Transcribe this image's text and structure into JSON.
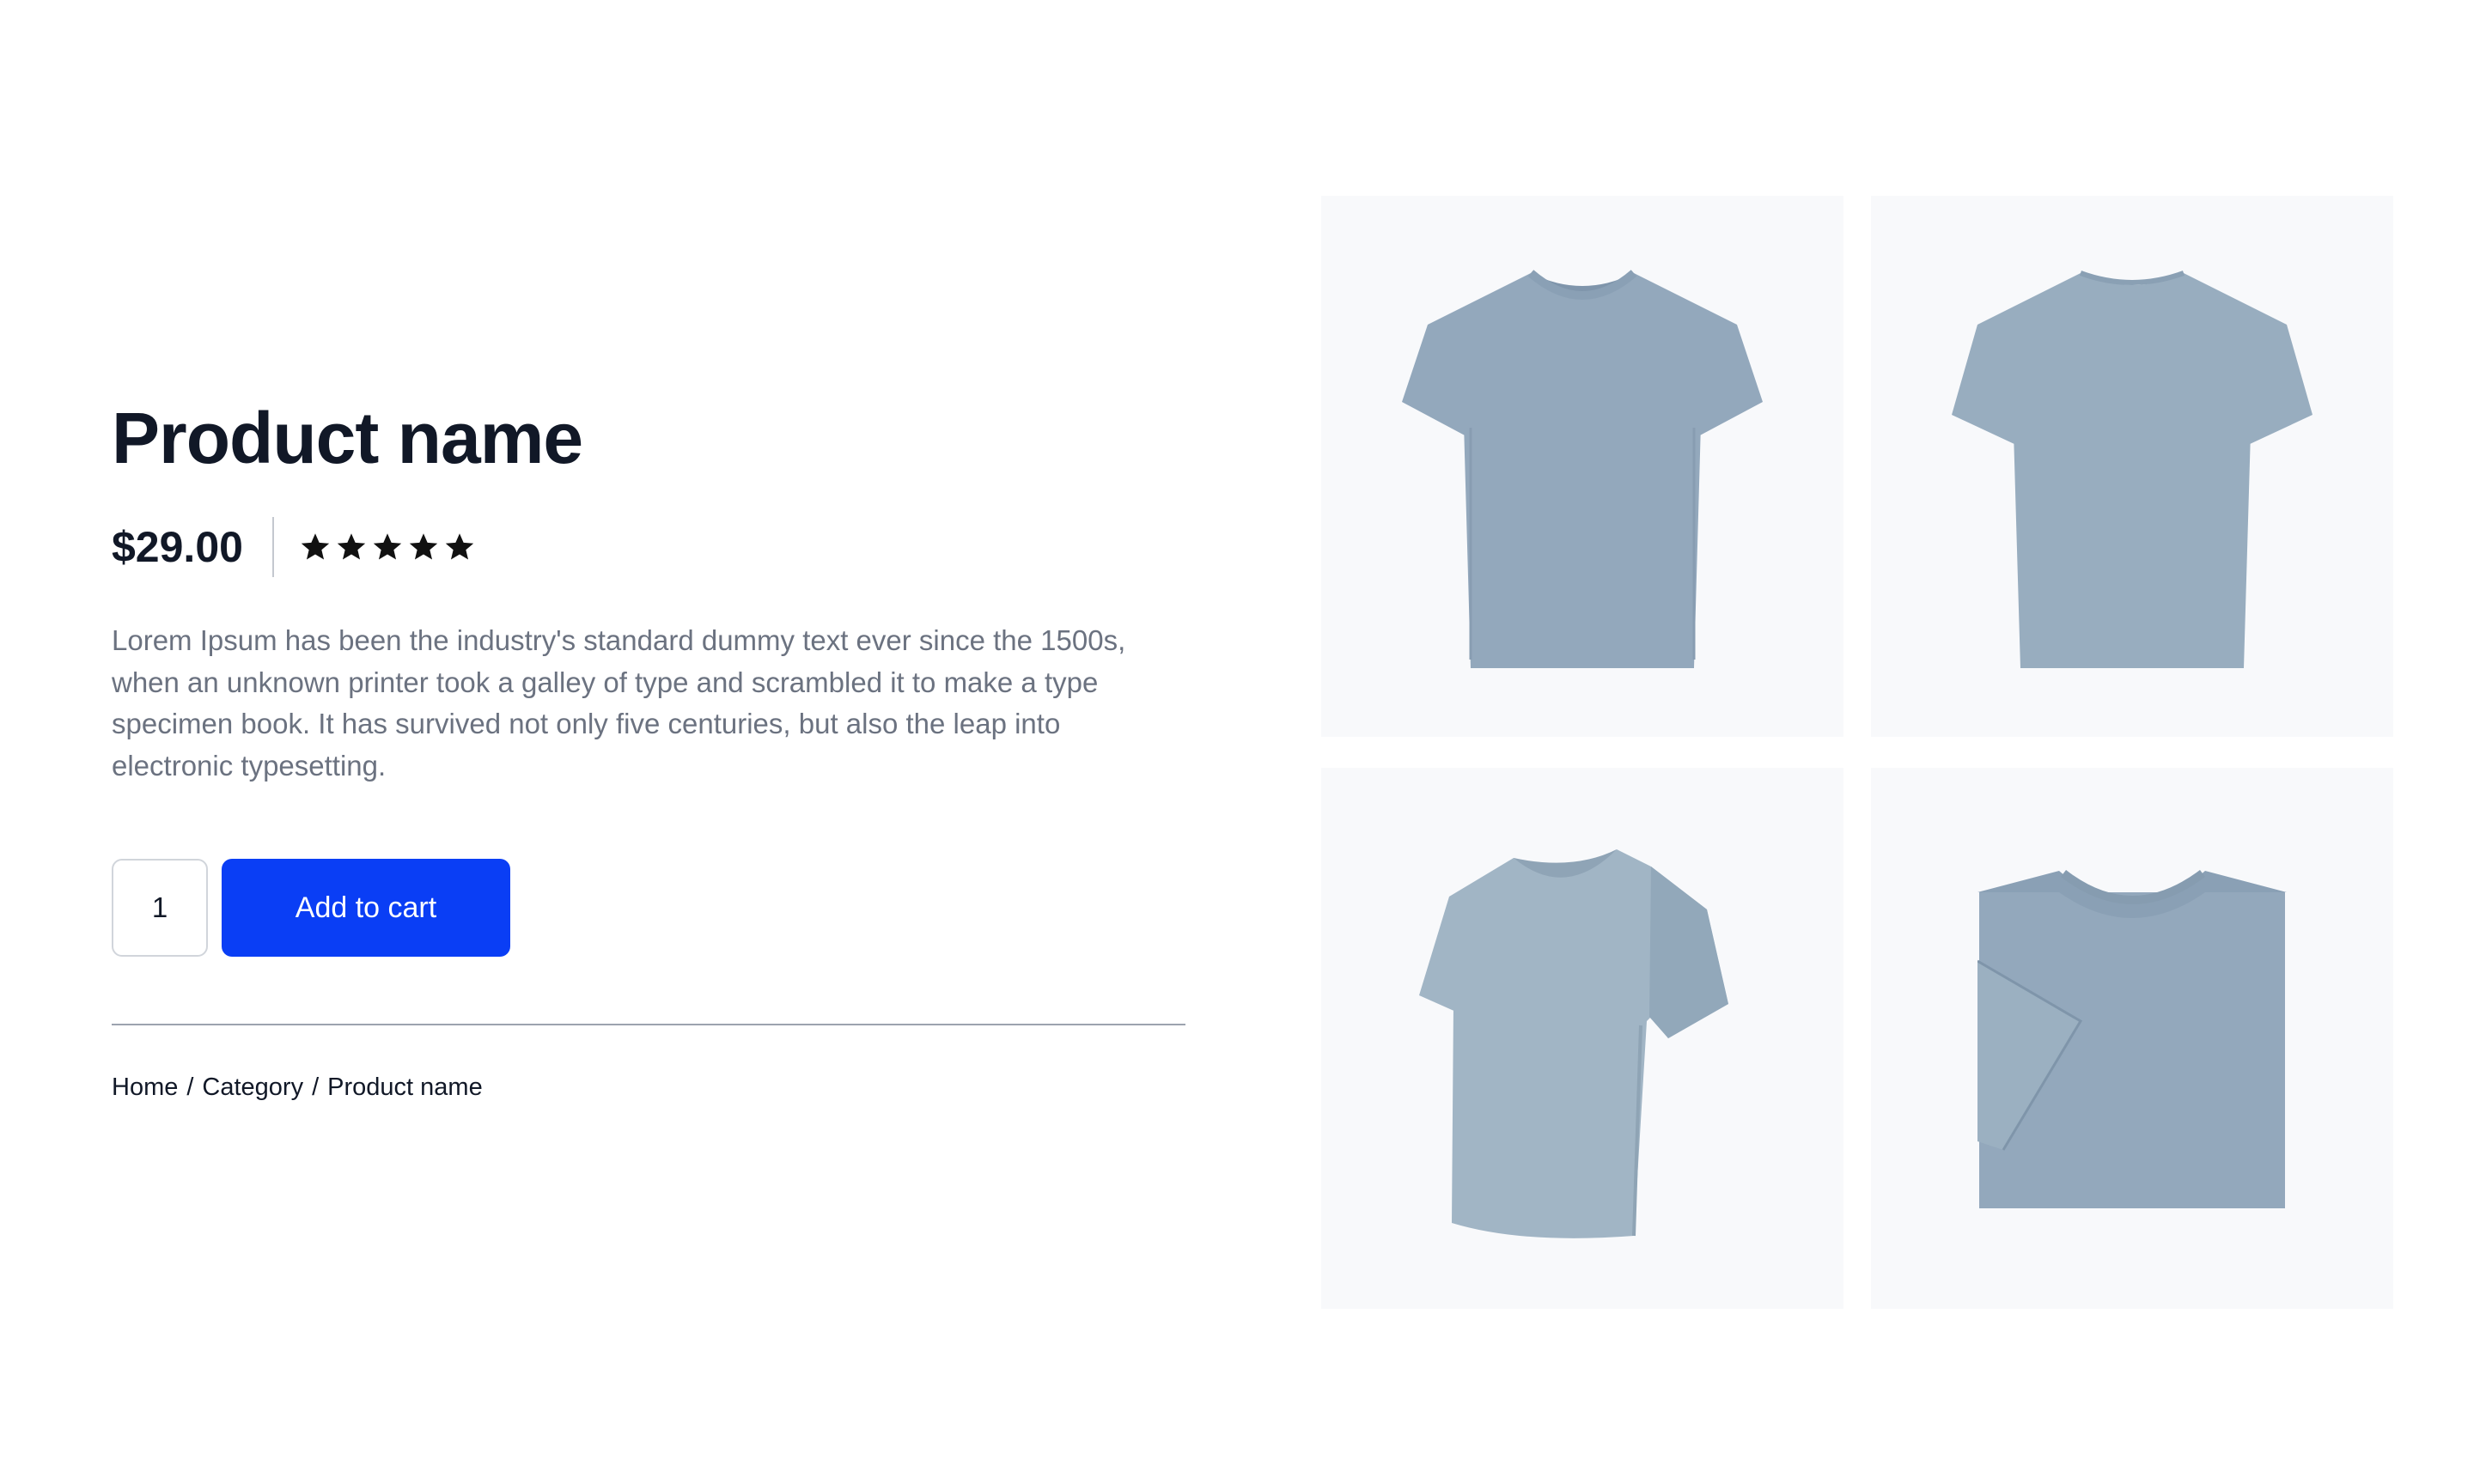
{
  "product": {
    "title": "Product name",
    "price": "$29.00",
    "rating": 5,
    "rating_max": 5,
    "description": "Lorem Ipsum has been the industry's standard dummy text ever since the 1500s, when an unknown printer took a galley of type and scrambled it to make a type specimen book. It has survived not only five centuries, but also the leap into electronic typesetting."
  },
  "cart": {
    "quantity": "1",
    "add_label": "Add to cart"
  },
  "breadcrumb": {
    "home": "Home",
    "category": "Category",
    "current": "Product name",
    "separator": "/"
  },
  "gallery": {
    "images": [
      {
        "view": "tshirt-front"
      },
      {
        "view": "tshirt-back"
      },
      {
        "view": "tshirt-angled"
      },
      {
        "view": "tshirt-folded"
      }
    ]
  },
  "colors": {
    "accent": "#0a3ef5",
    "title": "#111827",
    "body_text": "#6b7280",
    "shirt": "#93a8bc",
    "tile_bg": "#f8f9fb"
  }
}
